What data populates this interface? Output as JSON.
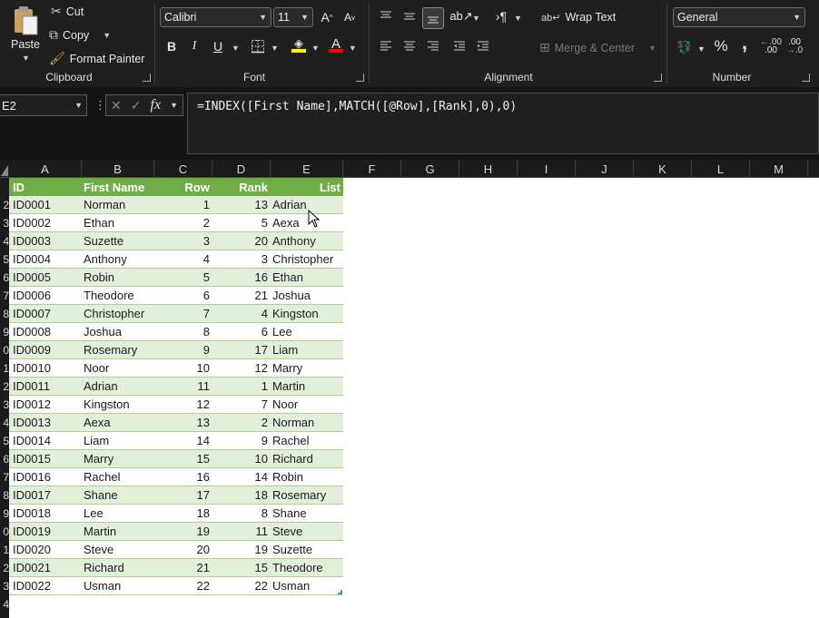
{
  "clipboard": {
    "paste_label": "Paste",
    "cut_label": "Cut",
    "copy_label": "Copy",
    "format_painter_label": "Format Painter",
    "group_label": "Clipboard"
  },
  "font": {
    "font_name": "Calibri",
    "font_size": "11",
    "group_label": "Font",
    "bold_label": "B",
    "italic_label": "I",
    "underline_label": "U",
    "font_color_label": "A",
    "fill_color": "#ffff00",
    "font_color": "#ff0000"
  },
  "alignment": {
    "wrap_text_label": "Wrap Text",
    "merge_center_label": "Merge & Center",
    "group_label": "Alignment"
  },
  "number": {
    "format": "General",
    "group_label": "Number",
    "percent_label": "%",
    "comma_label": ",",
    "increase_decimal_label": ".00",
    "decrease_decimal_label": ".00"
  },
  "formula_bar": {
    "name_box": "E2",
    "fx_label": "fx",
    "formula": "=INDEX([First Name],MATCH([@Row],[Rank],0),0)"
  },
  "columns": [
    "A",
    "B",
    "C",
    "D",
    "E",
    "F",
    "G",
    "H",
    "I",
    "J",
    "K",
    "L",
    "M"
  ],
  "row_numbers": [
    "",
    "2",
    "3",
    "4",
    "5",
    "6",
    "7",
    "8",
    "9",
    "0",
    "1",
    "2",
    "3",
    "4",
    "5",
    "6",
    "7",
    "8",
    "9",
    "0",
    "1",
    "2",
    "3",
    "4"
  ],
  "table": {
    "headers": [
      "ID",
      "First Name",
      "Row",
      "Rank",
      "List"
    ],
    "rows": [
      [
        "ID0001",
        "Norman",
        "1",
        "13",
        "Adrian"
      ],
      [
        "ID0002",
        "Ethan",
        "2",
        "5",
        "Aexa"
      ],
      [
        "ID0003",
        "Suzette",
        "3",
        "20",
        "Anthony"
      ],
      [
        "ID0004",
        "Anthony",
        "4",
        "3",
        "Christopher"
      ],
      [
        "ID0005",
        "Robin",
        "5",
        "16",
        "Ethan"
      ],
      [
        "ID0006",
        "Theodore",
        "6",
        "21",
        "Joshua"
      ],
      [
        "ID0007",
        "Christopher",
        "7",
        "4",
        "Kingston"
      ],
      [
        "ID0008",
        "Joshua",
        "8",
        "6",
        "Lee"
      ],
      [
        "ID0009",
        "Rosemary",
        "9",
        "17",
        "Liam"
      ],
      [
        "ID0010",
        "Noor",
        "10",
        "12",
        "Marry"
      ],
      [
        "ID0011",
        "Adrian",
        "11",
        "1",
        "Martin"
      ],
      [
        "ID0012",
        "Kingston",
        "12",
        "7",
        "Noor"
      ],
      [
        "ID0013",
        "Aexa",
        "13",
        "2",
        "Norman"
      ],
      [
        "ID0014",
        "Liam",
        "14",
        "9",
        "Rachel"
      ],
      [
        "ID0015",
        "Marry",
        "15",
        "10",
        "Richard"
      ],
      [
        "ID0016",
        "Rachel",
        "16",
        "14",
        "Robin"
      ],
      [
        "ID0017",
        "Shane",
        "17",
        "18",
        "Rosemary"
      ],
      [
        "ID0018",
        "Lee",
        "18",
        "8",
        "Shane"
      ],
      [
        "ID0019",
        "Martin",
        "19",
        "11",
        "Steve"
      ],
      [
        "ID0020",
        "Steve",
        "20",
        "19",
        "Suzette"
      ],
      [
        "ID0021",
        "Richard",
        "21",
        "15",
        "Theodore"
      ],
      [
        "ID0022",
        "Usman",
        "22",
        "22",
        "Usman"
      ]
    ]
  },
  "colors": {
    "table_header": "#70ad47",
    "table_band": "#e2efda",
    "ribbon_bg": "#1f1f1f"
  }
}
